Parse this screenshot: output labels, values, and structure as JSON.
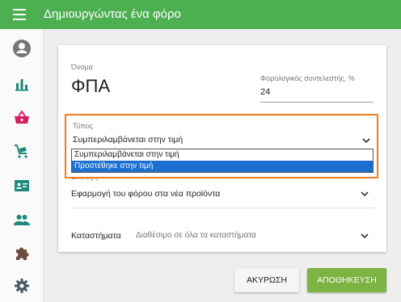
{
  "appbar": {
    "title": "Δημιουργώντας ένα φόρο"
  },
  "sidebar": {
    "items": [
      {
        "icon": "account-icon"
      },
      {
        "icon": "bar-chart-icon"
      },
      {
        "icon": "basket-icon"
      },
      {
        "icon": "cart-icon"
      },
      {
        "icon": "contact-card-icon"
      },
      {
        "icon": "people-icon"
      },
      {
        "icon": "puzzle-icon"
      },
      {
        "icon": "gear-icon"
      }
    ]
  },
  "form": {
    "name_label": "Όνομα",
    "name_value": "ΦΠΑ",
    "rate_label": "Φορολογικός συντελεστής, %",
    "rate_value": "24",
    "type_label": "Τύπος",
    "type_value": "Συμπεριλαμβάνεται στην τιμή",
    "type_options": [
      "Συμπεριλαμβάνεται στην τιμή",
      "Προστέθηκε στην τιμή"
    ],
    "option_label": "Επιλογή",
    "option_value": "Εφαρμογή του φόρου στα νέα προϊόντα",
    "stores_label": "Καταστήματα",
    "stores_value": "Διαθέσιμο σε όλα τα καταστήματα"
  },
  "buttons": {
    "cancel": "ΑΚΥΡΩΣΗ",
    "save": "ΑΠΟΘΗΚΕΥΣΗ"
  },
  "colors": {
    "primary": "#4caf50",
    "save": "#7cb342",
    "focus": "#f07c1e",
    "selected": "#1b6fd1",
    "icon_accent": "#1b8a7a",
    "basket": "#d81b60"
  }
}
